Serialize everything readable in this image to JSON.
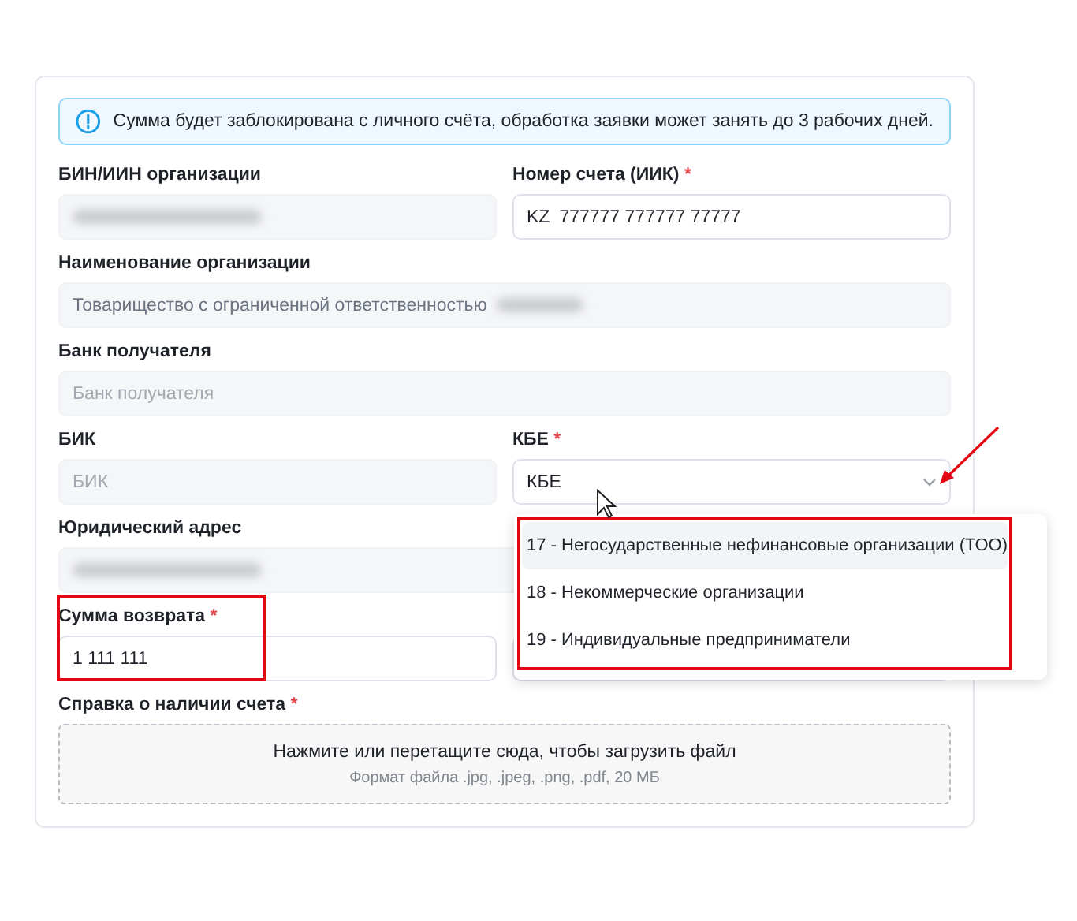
{
  "alert": {
    "text": "Сумма будет заблокирована с личного счёта, обработка заявки может занять до 3 рабочих дней."
  },
  "rows": [
    [
      {
        "kind": "text",
        "label": "БИН/ИИН организации",
        "required": false,
        "disabled": true,
        "redacted": true
      },
      {
        "kind": "text",
        "label": "Номер счета (ИИК)",
        "required": true,
        "required_mark": "*",
        "disabled": false,
        "prefix": "KZ",
        "value": "777777 777777 77777"
      }
    ],
    [
      {
        "kind": "text",
        "label": "Наименование организации",
        "disabled": true,
        "value": "Товарищество с ограниченной ответственностью",
        "redacted": true
      }
    ],
    [
      {
        "kind": "text",
        "label": "Банк получателя",
        "disabled": true,
        "placeholder": "Банк получателя"
      }
    ],
    [
      {
        "kind": "text",
        "label": "БИК",
        "required": false,
        "disabled": true,
        "placeholder": "БИК"
      },
      {
        "kind": "select",
        "label": "КБЕ",
        "required": true,
        "required_mark": "*",
        "disabled": false,
        "value": "КБЕ"
      }
    ],
    [
      {
        "kind": "text",
        "label": "Юридический адрес",
        "disabled": true,
        "redacted": true
      }
    ],
    [
      {
        "kind": "text",
        "label": "Сумма возврата",
        "required": true,
        "required_mark": "*",
        "disabled": false,
        "value": "1 111 111"
      },
      {
        "kind": "text",
        "disabled": false
      }
    ]
  ],
  "upload": {
    "label": "Справка о наличии счета",
    "required": true,
    "required_mark": "*",
    "title": "Нажмите или перетащите сюда, чтобы загрузить файл",
    "hint": "Формат файла .jpg, .jpeg, .png, .pdf, 20 МБ"
  },
  "dropdown": {
    "options": [
      {
        "label": "17 - Негосударственные нефинансовые организации (ТОО)",
        "selected": true
      },
      {
        "label": "18 - Некоммерческие организации",
        "selected": false
      },
      {
        "label": "19 - Индивидуальные предприниматели",
        "selected": false
      }
    ]
  }
}
